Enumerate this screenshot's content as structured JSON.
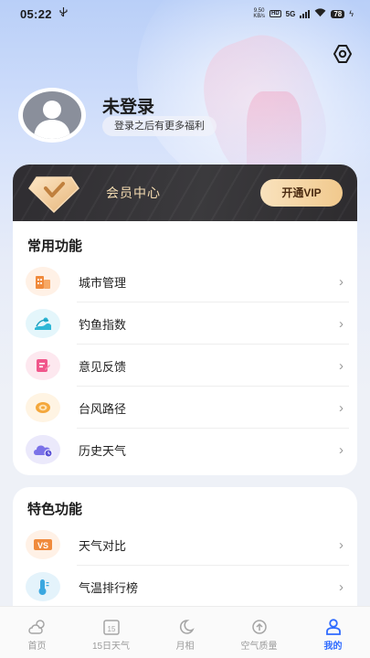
{
  "status_bar": {
    "time": "05:22",
    "speed_value": "9.50",
    "speed_unit": "KB/s",
    "hd": "HD",
    "network": "5G",
    "battery": "78"
  },
  "profile": {
    "title": "未登录",
    "subtitle": "登录之后有更多福利"
  },
  "vip": {
    "title": "会员中心",
    "button": "开通VIP"
  },
  "common": {
    "title": "常用功能",
    "items": [
      {
        "label": "城市管理",
        "icon": "city-icon"
      },
      {
        "label": "钓鱼指数",
        "icon": "fishing-icon"
      },
      {
        "label": "意见反馈",
        "icon": "feedback-icon"
      },
      {
        "label": "台风路径",
        "icon": "typhoon-icon"
      },
      {
        "label": "历史天气",
        "icon": "history-weather-icon"
      }
    ]
  },
  "special": {
    "title": "特色功能",
    "items": [
      {
        "label": "天气对比",
        "icon": "vs-icon"
      },
      {
        "label": "气温排行榜",
        "icon": "thermometer-icon"
      }
    ]
  },
  "tabbar": {
    "items": [
      {
        "label": "首页",
        "icon": "home-weather-icon"
      },
      {
        "label": "15日天气",
        "icon": "calendar-15-icon",
        "calendar_number": "15"
      },
      {
        "label": "月相",
        "icon": "moon-icon"
      },
      {
        "label": "空气质量",
        "icon": "air-quality-icon"
      },
      {
        "label": "我的",
        "icon": "user-icon"
      }
    ],
    "active_index": 4
  },
  "colors": {
    "accent": "#2f6bff",
    "vip_gold": "#f1c98d",
    "vip_dark": "#2f2d31"
  },
  "chevron": "›"
}
